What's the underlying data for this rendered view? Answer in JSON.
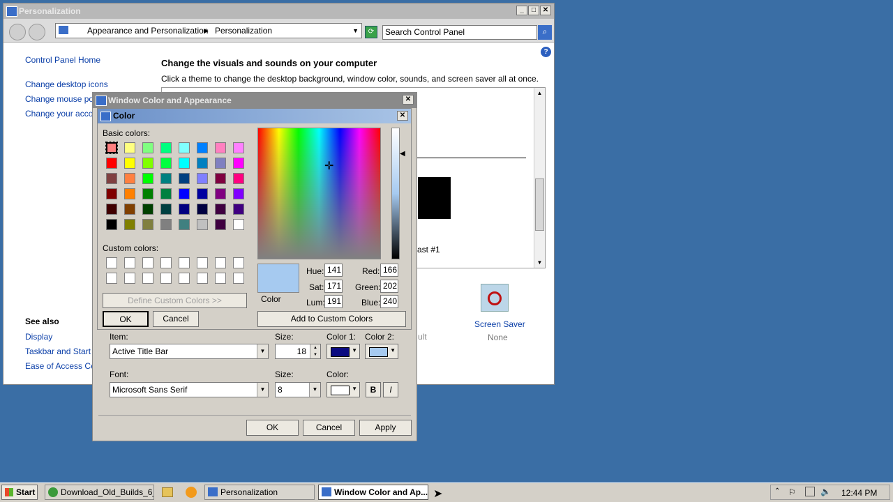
{
  "personalization": {
    "title": "Personalization",
    "breadcrumb": [
      "Appearance and Personalization",
      "Personalization"
    ],
    "search_placeholder": "Search Control Panel",
    "sidebar_home": "Control Panel Home",
    "sidebar_links": [
      "Change desktop icons",
      "Change mouse point",
      "Change your accou"
    ],
    "see_also_heading": "See also",
    "see_also_links": [
      "Display",
      "Taskbar and Start M",
      "Ease of Access Cent"
    ],
    "heading": "Change the visuals and sounds on your computer",
    "subtext": "Click a theme to change the desktop background, window color, sounds, and screen saver all at once.",
    "theme_name_fragment": "ast #1",
    "sound_value_fragment": "ult",
    "screensaver_label": "Screen Saver",
    "screensaver_value": "None"
  },
  "wca": {
    "title": "Window Color and Appearance",
    "item_label": "Item:",
    "item_value": "Active Title Bar",
    "size_label": "Size:",
    "size_value": "18",
    "color1_label": "Color 1:",
    "color2_label": "Color 2:",
    "font_label": "Font:",
    "font_value": "Microsoft Sans Serif",
    "font_size_label": "Size:",
    "font_size_value": "8",
    "font_color_label": "Color:",
    "bold_label": "B",
    "italic_label": "I",
    "ok": "OK",
    "cancel": "Cancel",
    "apply": "Apply",
    "color1": "#0a0a80",
    "color2": "#a6caf0",
    "font_color": "#ffffff"
  },
  "color_dialog": {
    "title": "Color",
    "basic_colors_label": "Basic colors:",
    "custom_colors_label": "Custom colors:",
    "define_custom": "Define Custom Colors >>",
    "ok": "OK",
    "cancel": "Cancel",
    "add_custom": "Add to Custom Colors",
    "color_label": "Color",
    "hue_label": "Hue:",
    "sat_label": "Sat:",
    "lum_label": "Lum:",
    "red_label": "Red:",
    "green_label": "Green:",
    "blue_label": "Blue:",
    "hue": "141",
    "sat": "171",
    "lum": "191",
    "red": "166",
    "green": "202",
    "blue": "240",
    "preview_color": "#a6caf0",
    "basic_colors": [
      "#ff8080",
      "#ffff80",
      "#80ff80",
      "#00ff80",
      "#80ffff",
      "#0080ff",
      "#ff80c0",
      "#ff80ff",
      "#ff0000",
      "#ffff00",
      "#80ff00",
      "#00ff40",
      "#00ffff",
      "#0080c0",
      "#8080c0",
      "#ff00ff",
      "#804040",
      "#ff8040",
      "#00ff00",
      "#008080",
      "#004080",
      "#8080ff",
      "#800040",
      "#ff0080",
      "#800000",
      "#ff8000",
      "#008000",
      "#008040",
      "#0000ff",
      "#0000a0",
      "#800080",
      "#8000ff",
      "#400000",
      "#804000",
      "#004000",
      "#004040",
      "#000080",
      "#000040",
      "#400040",
      "#400080",
      "#000000",
      "#808000",
      "#808040",
      "#808080",
      "#408080",
      "#c0c0c0",
      "#400040",
      "#ffffff"
    ]
  },
  "taskbar": {
    "start": "Start",
    "items": [
      "Download_Old_Builds_6_...",
      "Personalization",
      "Window Color and Ap..."
    ],
    "clock": "12:44 PM"
  }
}
